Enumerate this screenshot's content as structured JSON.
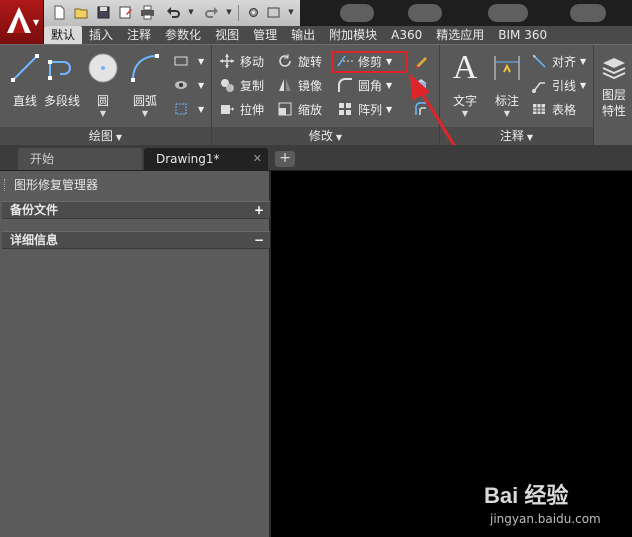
{
  "app": {
    "menu_icon": "autocad-a-logo"
  },
  "quick_access": {
    "buttons": [
      "new-icon",
      "open-icon",
      "save-icon",
      "saveas-icon",
      "plot-icon",
      "undo-icon",
      "redo-icon",
      "workspace-icon"
    ]
  },
  "ribbon_tabs": [
    "默认",
    "插入",
    "注释",
    "参数化",
    "视图",
    "管理",
    "输出",
    "附加模块",
    "A360",
    "精选应用",
    "BIM 360"
  ],
  "panels": {
    "draw": {
      "title": "绘图",
      "tools": [
        "直线",
        "多段线",
        "圆",
        "圆弧"
      ]
    },
    "modify": {
      "title": "修改",
      "rows": [
        [
          "移动",
          "旋转",
          "修剪"
        ],
        [
          "复制",
          "镜像",
          "圆角"
        ],
        [
          "拉伸",
          "缩放",
          "阵列"
        ]
      ]
    },
    "annotation": {
      "title": "注释",
      "big": [
        "文字",
        "标注"
      ],
      "small": [
        "对齐",
        "引线",
        "表格"
      ]
    },
    "layers": {
      "label": "图层特性"
    }
  },
  "highlighted_tool": "修剪",
  "doc_tabs": {
    "start": "开始",
    "drawing": "Drawing1*",
    "add": "+"
  },
  "palette": {
    "title": "图形修复管理器",
    "sections": [
      {
        "label": "备份文件",
        "toggle": "+"
      },
      {
        "label": "详细信息",
        "toggle": "−"
      }
    ]
  },
  "colors": {
    "accent_red": "#e0242a",
    "ribbon_bg": "#595959",
    "canvas_bg": "#000000"
  },
  "watermark": {
    "brand": "Bai 经验",
    "url": "jingyan.baidu.com"
  }
}
